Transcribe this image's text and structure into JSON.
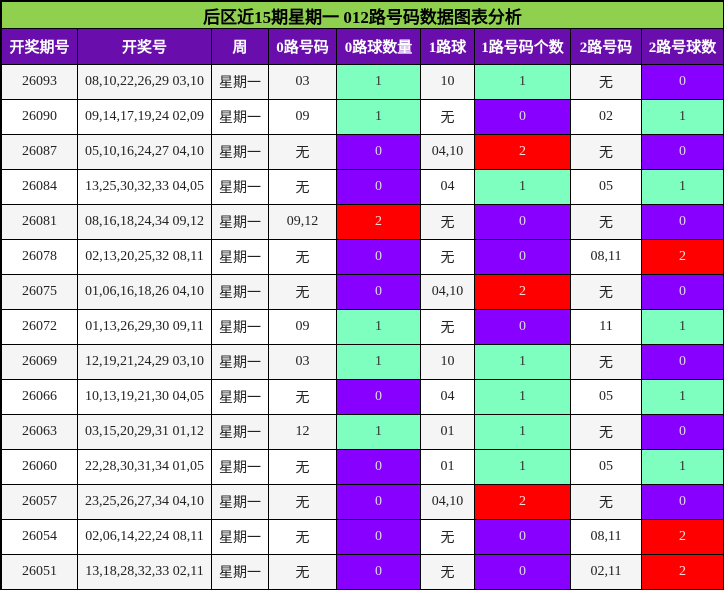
{
  "title": "后区近15期星期一 012路号码数据图表分析",
  "headers": [
    "开奖期号",
    "开奖号",
    "周",
    "0路号码",
    "0路球数量",
    "1路球",
    "1路号码个数",
    "2路号码",
    "2路号球数"
  ],
  "rows": [
    {
      "issue": "26093",
      "draw": "08,10,22,26,29 03,10",
      "weekday": "星期一",
      "r0_nums": "03",
      "r0_count": "1",
      "r1_nums": "10",
      "r1_count": "1",
      "r2_nums": "无",
      "r2_count": "0"
    },
    {
      "issue": "26090",
      "draw": "09,14,17,19,24 02,09",
      "weekday": "星期一",
      "r0_nums": "09",
      "r0_count": "1",
      "r1_nums": "无",
      "r1_count": "0",
      "r2_nums": "02",
      "r2_count": "1"
    },
    {
      "issue": "26087",
      "draw": "05,10,16,24,27 04,10",
      "weekday": "星期一",
      "r0_nums": "无",
      "r0_count": "0",
      "r1_nums": "04,10",
      "r1_count": "2",
      "r2_nums": "无",
      "r2_count": "0"
    },
    {
      "issue": "26084",
      "draw": "13,25,30,32,33 04,05",
      "weekday": "星期一",
      "r0_nums": "无",
      "r0_count": "0",
      "r1_nums": "04",
      "r1_count": "1",
      "r2_nums": "05",
      "r2_count": "1"
    },
    {
      "issue": "26081",
      "draw": "08,16,18,24,34 09,12",
      "weekday": "星期一",
      "r0_nums": "09,12",
      "r0_count": "2",
      "r1_nums": "无",
      "r1_count": "0",
      "r2_nums": "无",
      "r2_count": "0"
    },
    {
      "issue": "26078",
      "draw": "02,13,20,25,32 08,11",
      "weekday": "星期一",
      "r0_nums": "无",
      "r0_count": "0",
      "r1_nums": "无",
      "r1_count": "0",
      "r2_nums": "08,11",
      "r2_count": "2"
    },
    {
      "issue": "26075",
      "draw": "01,06,16,18,26 04,10",
      "weekday": "星期一",
      "r0_nums": "无",
      "r0_count": "0",
      "r1_nums": "04,10",
      "r1_count": "2",
      "r2_nums": "无",
      "r2_count": "0"
    },
    {
      "issue": "26072",
      "draw": "01,13,26,29,30 09,11",
      "weekday": "星期一",
      "r0_nums": "09",
      "r0_count": "1",
      "r1_nums": "无",
      "r1_count": "0",
      "r2_nums": "11",
      "r2_count": "1"
    },
    {
      "issue": "26069",
      "draw": "12,19,21,24,29 03,10",
      "weekday": "星期一",
      "r0_nums": "03",
      "r0_count": "1",
      "r1_nums": "10",
      "r1_count": "1",
      "r2_nums": "无",
      "r2_count": "0"
    },
    {
      "issue": "26066",
      "draw": "10,13,19,21,30 04,05",
      "weekday": "星期一",
      "r0_nums": "无",
      "r0_count": "0",
      "r1_nums": "04",
      "r1_count": "1",
      "r2_nums": "05",
      "r2_count": "1"
    },
    {
      "issue": "26063",
      "draw": "03,15,20,29,31 01,12",
      "weekday": "星期一",
      "r0_nums": "12",
      "r0_count": "1",
      "r1_nums": "01",
      "r1_count": "1",
      "r2_nums": "无",
      "r2_count": "0"
    },
    {
      "issue": "26060",
      "draw": "22,28,30,31,34 01,05",
      "weekday": "星期一",
      "r0_nums": "无",
      "r0_count": "0",
      "r1_nums": "01",
      "r1_count": "1",
      "r2_nums": "05",
      "r2_count": "1"
    },
    {
      "issue": "26057",
      "draw": "23,25,26,27,34 04,10",
      "weekday": "星期一",
      "r0_nums": "无",
      "r0_count": "0",
      "r1_nums": "04,10",
      "r1_count": "2",
      "r2_nums": "无",
      "r2_count": "0"
    },
    {
      "issue": "26054",
      "draw": "02,06,14,22,24 08,11",
      "weekday": "星期一",
      "r0_nums": "无",
      "r0_count": "0",
      "r1_nums": "无",
      "r1_count": "0",
      "r2_nums": "08,11",
      "r2_count": "2"
    },
    {
      "issue": "26051",
      "draw": "13,18,28,32,33 02,11",
      "weekday": "星期一",
      "r0_nums": "无",
      "r0_count": "0",
      "r1_nums": "无",
      "r1_count": "0",
      "r2_nums": "02,11",
      "r2_count": "2"
    }
  ],
  "colors": {
    "title_bg": "#8fd14f",
    "header_bg": "#6a0dad",
    "count_0": "#8800ff",
    "count_1": "#7fffbf",
    "count_2": "#ff0000"
  }
}
